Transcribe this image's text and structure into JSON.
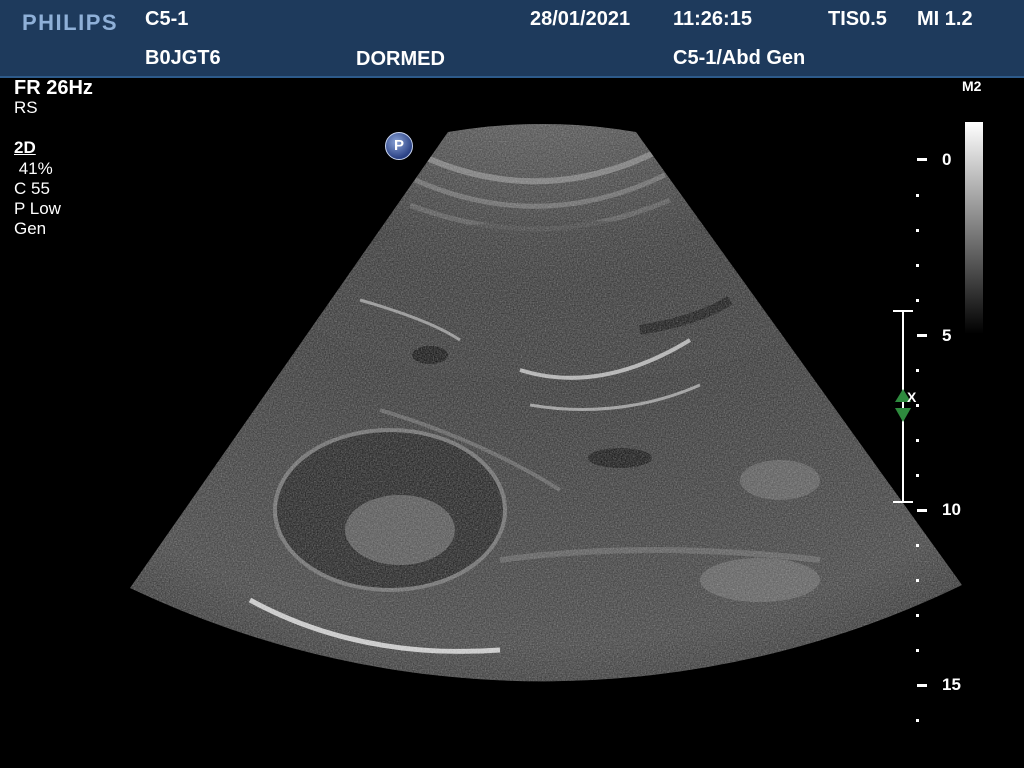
{
  "header": {
    "brand": "PHILIPS",
    "transducer": "C5-1",
    "date": "28/01/2021",
    "time": "11:26:15",
    "tis": "TIS0.5",
    "mi": "MI 1.2",
    "patient_id": "B0JGT6",
    "institution": "DORMED",
    "preset": "C5-1/Abd Gen"
  },
  "params": {
    "frame_rate": "FR 26Hz",
    "rs": "RS",
    "mode": "2D",
    "gain": " 41%",
    "compression": "C 55",
    "power": "P Low",
    "gen": "Gen"
  },
  "badge": {
    "letter": "P"
  },
  "grayscale": {
    "label": "M2"
  },
  "depth_scale": {
    "labels": [
      "0",
      "5",
      "10",
      "15"
    ],
    "focus_marker": "X"
  },
  "colors": {
    "header_bg": "#1e3a5c",
    "brand": "#8fb0d8",
    "focus_marker": "#2e8b3e"
  }
}
